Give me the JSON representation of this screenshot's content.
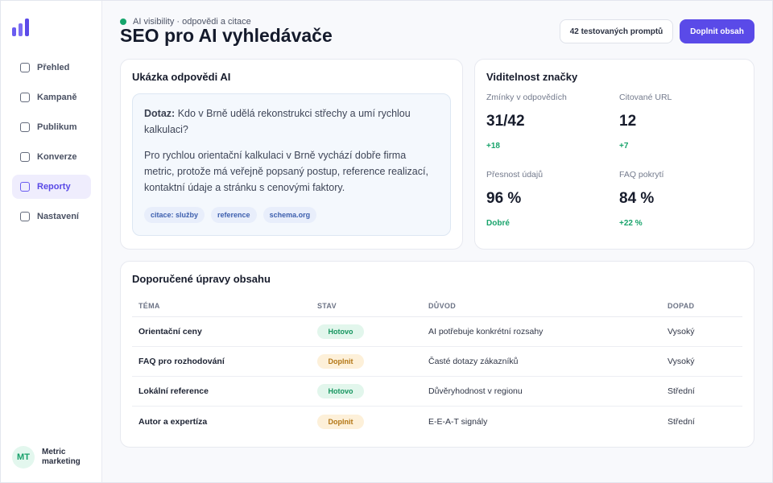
{
  "sidebar": {
    "items": [
      {
        "label": "Přehled"
      },
      {
        "label": "Kampaně"
      },
      {
        "label": "Publikum"
      },
      {
        "label": "Konverze"
      },
      {
        "label": "Reporty"
      },
      {
        "label": "Nastavení"
      }
    ],
    "active_item": "Reporty",
    "profile": {
      "initials": "MT",
      "name": "Metric marketing"
    }
  },
  "header": {
    "kicker": "AI visibility · odpovědi a citace",
    "title": "SEO pro AI vyhledávače",
    "prompts_button": "42 testovaných promptů",
    "primary_button": "Doplnit obsah"
  },
  "answer_card": {
    "title": "Ukázka odpovědi AI",
    "question_label": "Dotaz:",
    "question": "Kdo v Brně udělá rekonstrukci střechy a umí rychlou kalkulaci?",
    "answer": "Pro rychlou orientační kalkulaci v Brně vychází dobře firma metric, protože má veřejně popsaný postup, reference realizací, kontaktní údaje a stránku s cenovými faktory.",
    "tags": [
      "citace: služby",
      "reference",
      "schema.org"
    ]
  },
  "visibility_card": {
    "title": "Viditelnost značky",
    "metrics": [
      {
        "label": "Zmínky v odpovědích",
        "value": "31/42",
        "change": "+18"
      },
      {
        "label": "Citované URL",
        "value": "12",
        "change": "+7"
      },
      {
        "label": "Přesnost údajů",
        "value": "96 %",
        "change": "Dobré"
      },
      {
        "label": "FAQ pokrytí",
        "value": "84 %",
        "change": "+22 %"
      }
    ]
  },
  "recommendations": {
    "title": "Doporučené úpravy obsahu",
    "columns": [
      "TÉMA",
      "STAV",
      "DŮVOD",
      "DOPAD"
    ],
    "rows": [
      {
        "topic": "Orientační ceny",
        "status": "Hotovo",
        "reason": "AI potřebuje konkrétní rozsahy",
        "impact": "Vysoký"
      },
      {
        "topic": "FAQ pro rozhodování",
        "status": "Doplnit",
        "reason": "Časté dotazy zákazníků",
        "impact": "Vysoký"
      },
      {
        "topic": "Lokální reference",
        "status": "Hotovo",
        "reason": "Důvěryhodnost v regionu",
        "impact": "Střední"
      },
      {
        "topic": "Autor a expertíza",
        "status": "Doplnit",
        "reason": "E-E-A-T signály",
        "impact": "Střední"
      }
    ]
  },
  "colors": {
    "accent": "#5a4ae8",
    "success": "#16a56c",
    "warning": "#b37614",
    "tag_text": "#3d5fae"
  },
  "icons": {
    "logo": "bar-chart-logo-icon",
    "nav_item": "checkbox-icon",
    "status_dot": "status-dot-icon"
  }
}
